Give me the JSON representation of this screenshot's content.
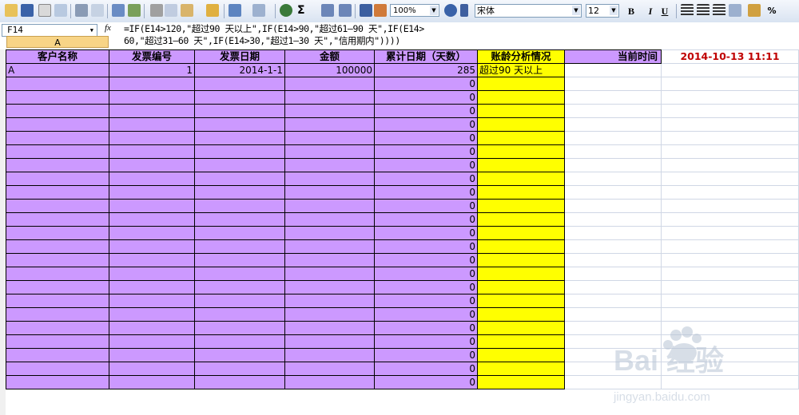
{
  "toolbar": {
    "zoom": "100%",
    "font_name": "宋体",
    "font_size": "12",
    "bold": "B",
    "italic": "I",
    "underline": "U",
    "percent": "%",
    "sigma": "Σ"
  },
  "formula_bar": {
    "cell_ref": "F14",
    "fx": "fx",
    "formula": "=IF(E14>120,\"超过90 天以上\",IF(E14>90,\"超过61—90 天\",IF(E14>\n60,\"超过31—60 天\",IF(E14>30,\"超过1—30 天\",\"信用期内\"))))",
    "column_header": "A"
  },
  "sheet": {
    "headers": [
      "客户名称",
      "发票编号",
      "发票日期",
      "金额",
      "累计日期（天数）",
      "账龄分析情况"
    ],
    "current_time_label": "当前时间",
    "current_time_value": "2014-10-13 11:11",
    "rows": [
      [
        "A",
        "1",
        "2014-1-1",
        "100000",
        "285",
        "超过90 天以上"
      ],
      [
        "",
        "",
        "",
        "",
        "0",
        ""
      ],
      [
        "",
        "",
        "",
        "",
        "0",
        ""
      ],
      [
        "",
        "",
        "",
        "",
        "0",
        ""
      ],
      [
        "",
        "",
        "",
        "",
        "0",
        ""
      ],
      [
        "",
        "",
        "",
        "",
        "0",
        ""
      ],
      [
        "",
        "",
        "",
        "",
        "0",
        ""
      ],
      [
        "",
        "",
        "",
        "",
        "0",
        ""
      ],
      [
        "",
        "",
        "",
        "",
        "0",
        ""
      ],
      [
        "",
        "",
        "",
        "",
        "0",
        ""
      ],
      [
        "",
        "",
        "",
        "",
        "0",
        ""
      ],
      [
        "",
        "",
        "",
        "",
        "0",
        ""
      ],
      [
        "",
        "",
        "",
        "",
        "0",
        ""
      ],
      [
        "",
        "",
        "",
        "",
        "0",
        ""
      ],
      [
        "",
        "",
        "",
        "",
        "0",
        ""
      ],
      [
        "",
        "",
        "",
        "",
        "0",
        ""
      ],
      [
        "",
        "",
        "",
        "",
        "0",
        ""
      ],
      [
        "",
        "",
        "",
        "",
        "0",
        ""
      ],
      [
        "",
        "",
        "",
        "",
        "0",
        ""
      ],
      [
        "",
        "",
        "",
        "",
        "0",
        ""
      ],
      [
        "",
        "",
        "",
        "",
        "0",
        ""
      ],
      [
        "",
        "",
        "",
        "",
        "0",
        ""
      ],
      [
        "",
        "",
        "",
        "",
        "0",
        ""
      ],
      [
        "",
        "",
        "",
        "",
        "0",
        ""
      ]
    ]
  },
  "watermark": {
    "brand": "Bai 经验",
    "url": "jingyan.baidu.com"
  },
  "colors": {
    "purple_fill": "#cc99ff",
    "yellow_fill": "#ffff00",
    "time_red": "#c00000"
  }
}
